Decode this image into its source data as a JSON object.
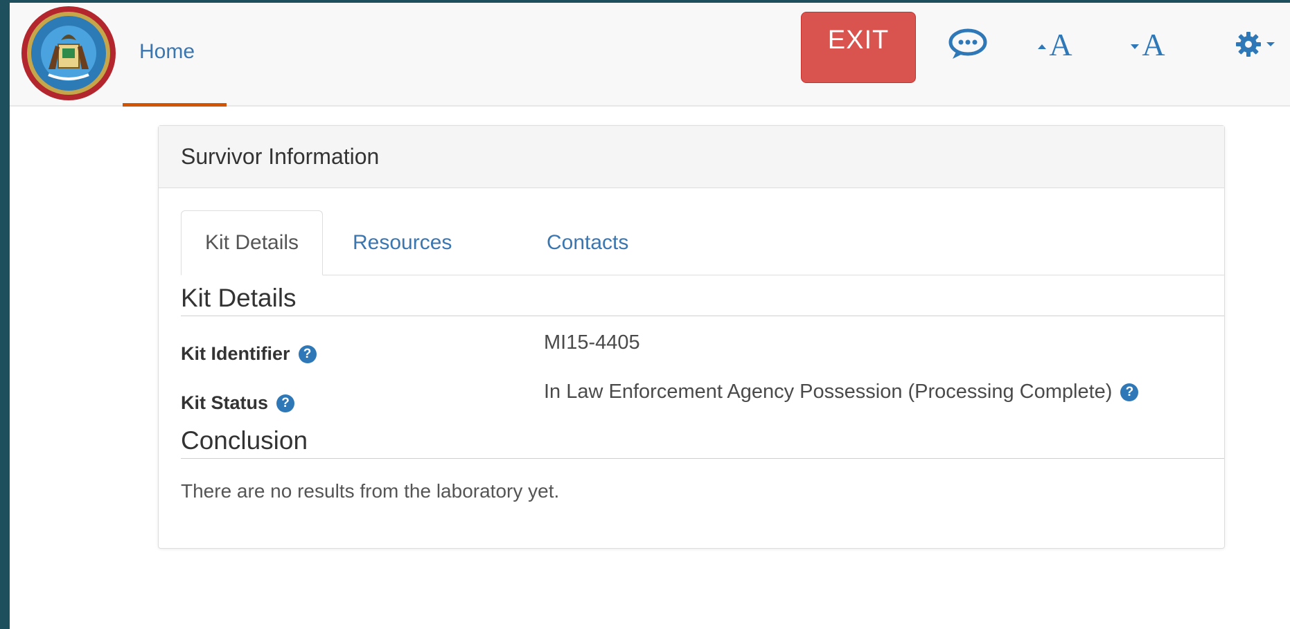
{
  "nav": {
    "home_label": "Home",
    "exit_label": "EXIT",
    "font_increase_label": "A",
    "font_decrease_label": "A",
    "icons": [
      "state-seal-logo",
      "chat-icon",
      "font-increase-icon",
      "font-decrease-icon",
      "gear-icon"
    ]
  },
  "panel": {
    "heading": "Survivor Information",
    "tabs": [
      {
        "label": "Kit Details",
        "active": true
      },
      {
        "label": "Resources",
        "active": false
      },
      {
        "label": "Contacts",
        "active": false
      }
    ],
    "kit_details": {
      "title": "Kit Details",
      "identifier_label": "Kit Identifier",
      "identifier_value": "MI15-4405",
      "status_label": "Kit Status",
      "status_value": "In Law Enforcement Agency Possession (Processing Complete)"
    },
    "conclusion": {
      "title": "Conclusion",
      "text": "There are no results from the laboratory yet."
    }
  },
  "colors": {
    "exit_button": "#d9534f",
    "link": "#3a76b0",
    "active_nav_underline": "#d35400",
    "help_icon": "#2f78b8"
  }
}
